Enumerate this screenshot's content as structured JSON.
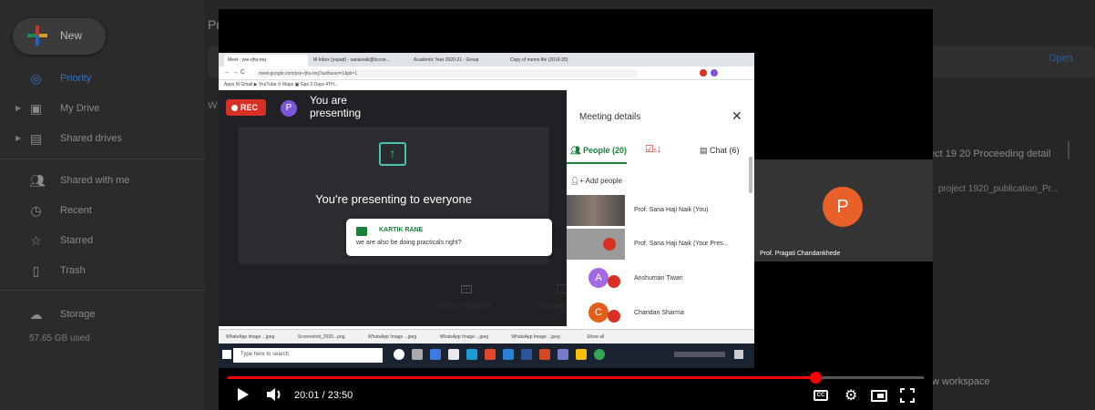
{
  "drive": {
    "new_label": "New",
    "nav": [
      {
        "label": "Priority",
        "icon": "check-circle-icon",
        "active": true
      },
      {
        "label": "My Drive",
        "icon": "drive-icon"
      },
      {
        "label": "Shared drives",
        "icon": "shared-drives-icon"
      },
      {
        "label": "Shared with me",
        "icon": "people-icon"
      },
      {
        "label": "Recent",
        "icon": "clock-icon"
      },
      {
        "label": "Starred",
        "icon": "star-icon"
      },
      {
        "label": "Trash",
        "icon": "trash-icon"
      },
      {
        "label": "Storage",
        "icon": "cloud-icon"
      }
    ],
    "storage_used": "57.65 GB used",
    "main_title": "Pr",
    "open_label": "Open",
    "w_label": "W",
    "right_item_1": "ect 19 20 Proceeding detail",
    "right_item_2": "project 1920_publication_Pr...",
    "right_item_3": "w workspace"
  },
  "browser": {
    "tabs": [
      {
        "label": "Meet - yse-rjhu-tnq"
      },
      {
        "label": "M Inbox (yopad) - sanaivaik@kccoe..."
      },
      {
        "label": "Academic Year 2020-21 - Group"
      },
      {
        "label": "Copy of memo file (2019-20)"
      }
    ],
    "url": "meet.google.com/yse-rjhu-tnq?authuser=1&pli=1",
    "bookmarks": "Apps   M Gmail   ▶ YouTube   ⚲ Maps   ▣ Gps 3 Days 4TH..."
  },
  "meet": {
    "rec_label": "REC",
    "presenter_initial": "P",
    "presenting_text": "You are presenting",
    "presenting_to_everyone": "You're presenting to everyone",
    "chat_popup": {
      "name": "KARTIK RANE",
      "message": "we are also be doing practicals right?"
    },
    "captions_label": "Turn on captions",
    "caption_icon": "CC",
    "present_label": "You are pre",
    "details": {
      "title": "Meeting details",
      "people_tab": "People (20)",
      "tasks_badge": "5",
      "chat_tab": "Chat (6)",
      "add_people": "Add people",
      "participants": [
        {
          "name": "Prof. Sana Haji Naik (You)",
          "kind": "photo"
        },
        {
          "name": "Prof. Sana Haji Naik (Your Pres...",
          "kind": "photo-muted"
        },
        {
          "name": "Anshuman Tiwari",
          "initial": "A",
          "color": "#a26be2"
        },
        {
          "name": "Chandan Sharma",
          "initial": "C",
          "color": "#e0601b"
        }
      ]
    },
    "downloads": [
      "WhatsApp Image ...jpeg",
      "Screenshot_2020...png",
      "WhatsApp Image ...jpeg",
      "WhatsApp Image ...jpeg",
      "WhatsApp Image ...jpeg"
    ],
    "downloads_show_all": "Show all",
    "taskbar_search": "Type here to search"
  },
  "tile": {
    "initial": "P",
    "name": "Prof. Pragati Chandankhede",
    "color": "#e8602a"
  },
  "player": {
    "time": "20:01 / 23:50",
    "progress": 0.844,
    "cc_label": "CC"
  }
}
